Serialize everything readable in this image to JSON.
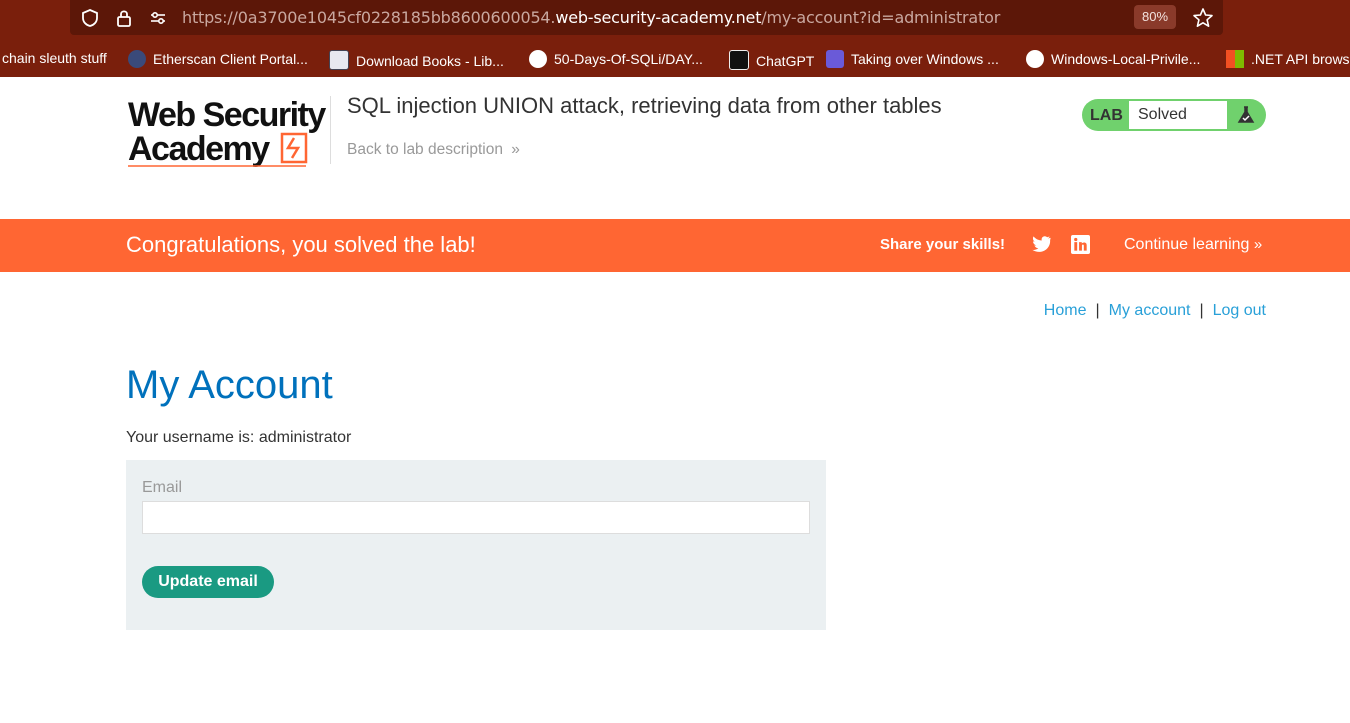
{
  "browser": {
    "url_prefix": "https://0a3700e1045cf0228185bb8600600054.",
    "url_domain": "web-security-academy.net",
    "url_path": "/my-account?id=administrator",
    "zoom": "80%",
    "bookmarks": [
      {
        "label": "chain sleuth stuff",
        "icon": "none"
      },
      {
        "label": "Etherscan Client Portal...",
        "icon": "etherscan-icon"
      },
      {
        "label": "Download Books - Lib...",
        "icon": "book-icon"
      },
      {
        "label": "50-Days-Of-SQLi/DAY...",
        "icon": "github-icon"
      },
      {
        "label": "ChatGPT",
        "icon": "chatgpt-icon"
      },
      {
        "label": "Taking over Windows ...",
        "icon": "ri-icon"
      },
      {
        "label": "Windows-Local-Privile...",
        "icon": "github-icon"
      },
      {
        "label": ".NET API brows",
        "icon": "microsoft-icon"
      }
    ]
  },
  "header": {
    "logo_line1": "Web Security",
    "logo_line2": "Academy",
    "lab_title": "SQL injection UNION attack, retrieving data from other tables",
    "back_link": "Back to lab description",
    "badge_label": "LAB",
    "badge_status": "Solved"
  },
  "banner": {
    "congrats": "Congratulations, you solved the lab!",
    "share": "Share your skills!",
    "continue": "Continue learning"
  },
  "nav": {
    "home": "Home",
    "account": "My account",
    "logout": "Log out",
    "separator": "|"
  },
  "main": {
    "title": "My Account",
    "username_text": "Your username is: administrator",
    "email_label": "Email",
    "email_value": "",
    "update_button": "Update email"
  },
  "colors": {
    "browser_frame": "#7a1f0c",
    "banner": "#ff6633",
    "title_blue": "#0071bc",
    "link_blue": "#29a0d8",
    "button_green": "#1a9a82",
    "badge_green": "#70d16d"
  }
}
